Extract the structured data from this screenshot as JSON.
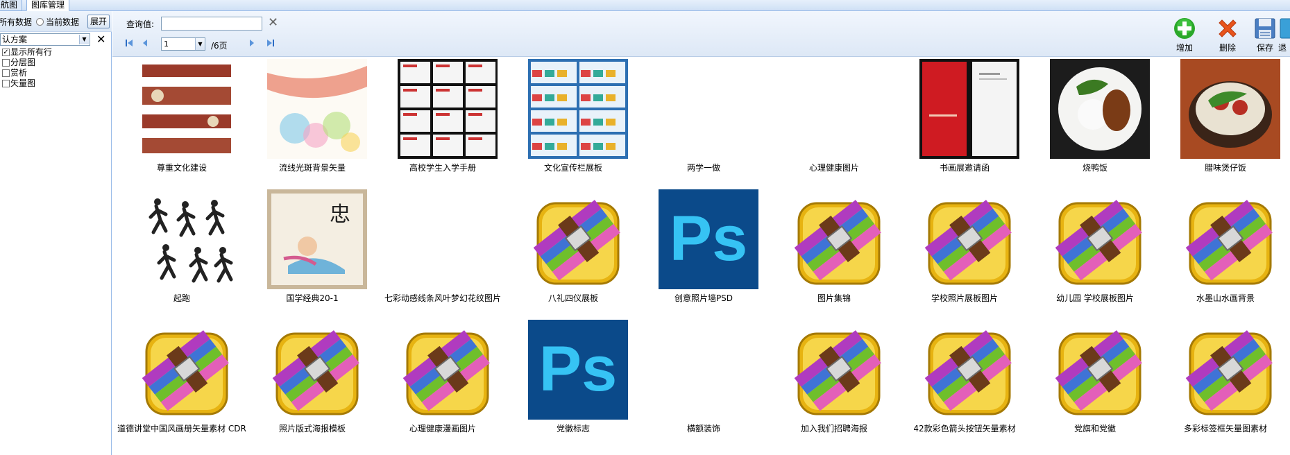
{
  "tabs": [
    {
      "label": "航图"
    },
    {
      "label": "图库管理"
    }
  ],
  "left_panel": {
    "radio_all": "所有数据",
    "radio_current": "当前数据",
    "expand_button": "展开",
    "scheme_value": "认方案",
    "layers": [
      {
        "label": "显示所有行",
        "checked": true,
        "mark": "✓"
      },
      {
        "label": "分层图",
        "checked": false,
        "mark": ""
      },
      {
        "label": "赏析",
        "checked": false,
        "mark": ""
      },
      {
        "label": "矢量图",
        "checked": false,
        "mark": ""
      }
    ]
  },
  "toolbar": {
    "query_label": "查询值:",
    "query_value": "",
    "page_number": "1",
    "page_total": "/6页",
    "actions": [
      {
        "label": "增加",
        "icon": "add-icon"
      },
      {
        "label": "删除",
        "icon": "delete-icon"
      },
      {
        "label": "保存",
        "icon": "save-icon"
      },
      {
        "label": "退",
        "icon": "exit-icon"
      }
    ]
  },
  "gallery": {
    "items": [
      {
        "caption": "尊重文化建设",
        "thumb": "culture-wall-image"
      },
      {
        "caption": "流线光斑背景矢量",
        "thumb": "colorful-swirl-image"
      },
      {
        "caption": "高校学生入学手册",
        "thumb": "brochure-image"
      },
      {
        "caption": "文化宣传栏展板",
        "thumb": "display-board-image"
      },
      {
        "caption": "两学一做",
        "thumb": ""
      },
      {
        "caption": "心理健康图片",
        "thumb": ""
      },
      {
        "caption": "书画展邀请函",
        "thumb": "red-invitation-image"
      },
      {
        "caption": "烧鸭饭",
        "thumb": "roast-duck-rice-image"
      },
      {
        "caption": "腊味煲仔饭",
        "thumb": "clay-pot-rice-image"
      },
      {
        "caption": "起跑",
        "thumb": "runners-silhouette-image"
      },
      {
        "caption": "国学经典20-1",
        "thumb": "classics-poster-image"
      },
      {
        "caption": "七彩动感线条风叶梦幻花纹图片",
        "thumb": ""
      },
      {
        "caption": "八礼四仪展板",
        "thumb": "archive-icon"
      },
      {
        "caption": "创意照片墙PSD",
        "thumb": "photoshop-icon"
      },
      {
        "caption": "图片集锦",
        "thumb": "archive-icon"
      },
      {
        "caption": "学校照片展板图片",
        "thumb": "archive-icon"
      },
      {
        "caption": "幼儿园 学校展板图片",
        "thumb": "archive-icon"
      },
      {
        "caption": "水墨山水画背景",
        "thumb": "archive-icon"
      },
      {
        "caption": "道德讲堂中国风画册矢量素材 CDR",
        "thumb": "archive-icon"
      },
      {
        "caption": "照片版式海报模板",
        "thumb": "archive-icon"
      },
      {
        "caption": "心理健康漫画图片",
        "thumb": "archive-icon"
      },
      {
        "caption": "党徽标志",
        "thumb": "photoshop-icon"
      },
      {
        "caption": "横额装饰",
        "thumb": ""
      },
      {
        "caption": "加入我们招聘海报",
        "thumb": "archive-icon"
      },
      {
        "caption": "42款彩色箭头按钮矢量素材",
        "thumb": "archive-icon"
      },
      {
        "caption": "党旗和党徽",
        "thumb": "archive-icon"
      },
      {
        "caption": "多彩标签框矢量图素材",
        "thumb": "archive-icon"
      }
    ]
  },
  "colors": {
    "toolbar_bg": "#dde8f6",
    "border": "#99bbe8",
    "photoshop_blue": "#0b4a8a",
    "photoshop_text": "#36c3f4"
  }
}
